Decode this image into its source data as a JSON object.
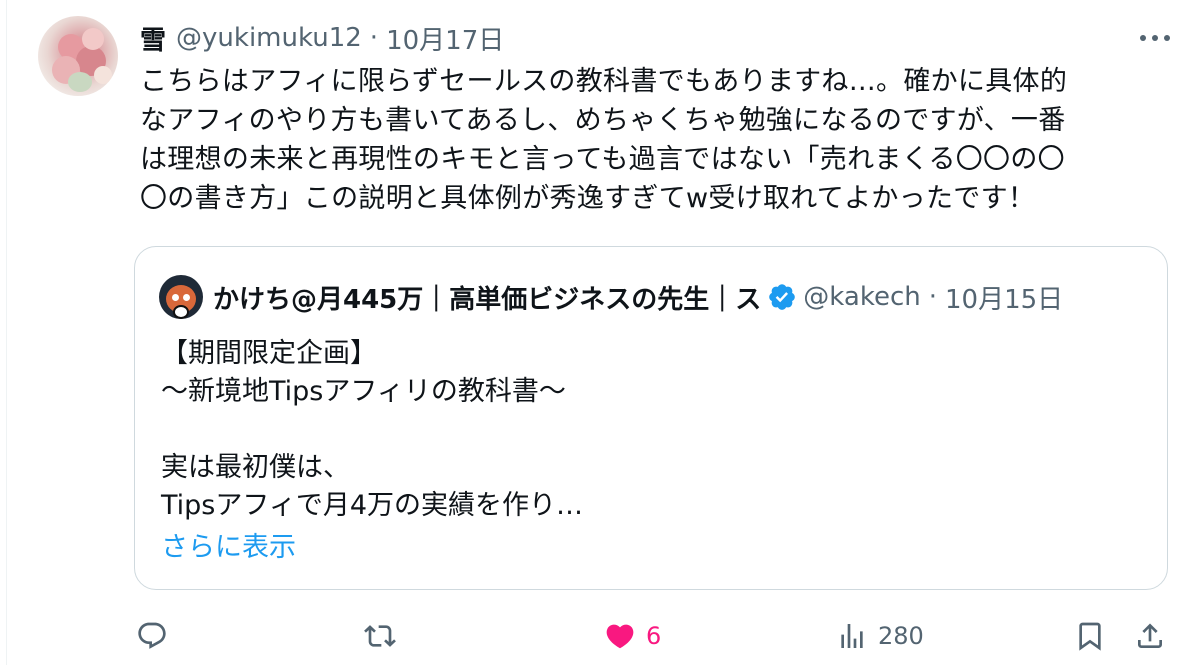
{
  "tweet": {
    "author_name": "雪",
    "handle": "@yukimuku12",
    "separator": "·",
    "time": "10月17日",
    "text": "こちらはアフィに限らずセールスの教科書でもありますね…。確かに具体的\nなアフィのやり方も書いてあるし、めちゃくちゃ勉強になるのですが、一番\nは理想の未来と再現性のキモと言っても過言ではない「売れまくる〇〇の〇\n〇の書き方」この説明と具体例が秀逸すぎてw受け取れてよかったです！"
  },
  "quote": {
    "author_name": "かけち@月445万｜高単価ビジネスの先生｜ス",
    "handle": "@kakech",
    "separator": "·",
    "time": "10月15日",
    "text": "【期間限定企画】\n〜新境地Tipsアフィリの教科書〜\n\n実は最初僕は、\nTipsアフィで月4万の実績を作り…",
    "show_more": "さらに表示"
  },
  "actions": {
    "reply_count": "",
    "retweet_count": "",
    "like_count": "6",
    "views_count": "280"
  },
  "colors": {
    "accent": "#1d9bf0",
    "like": "#f91880",
    "secondary_text": "#536471",
    "border": "#cfd9de",
    "verified": "#1d9bf0"
  },
  "icons": {
    "more": "more-horizontal-icon",
    "verified": "verified-badge-icon",
    "reply": "reply-icon",
    "retweet": "retweet-icon",
    "like": "heart-filled-icon",
    "views": "views-chart-icon",
    "bookmark": "bookmark-icon",
    "share": "share-icon"
  }
}
